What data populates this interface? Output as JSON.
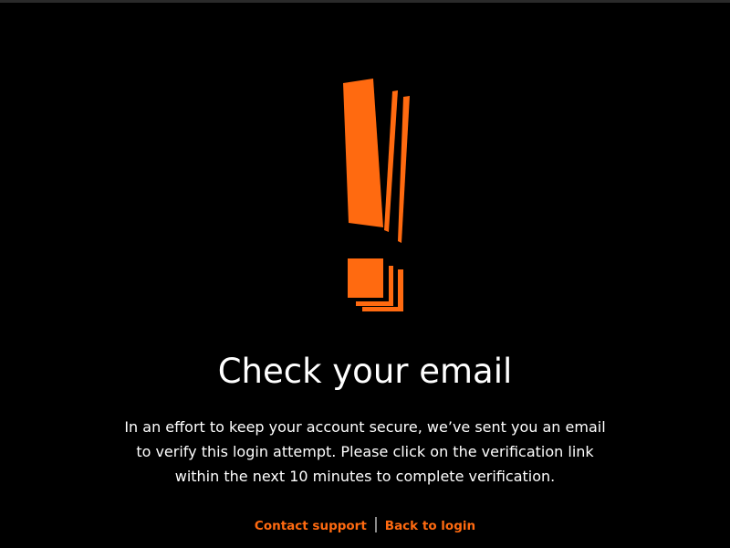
{
  "colors": {
    "background": "#000000",
    "accent": "#ff6a10",
    "text": "#ffffff",
    "separator": "#8a8a8a"
  },
  "icon": "exclamation-icon",
  "title": "Check your email",
  "message": "In an effort to keep your account secure, we’ve sent you an email to verify this login attempt. Please click on the verification link within the next 10 minutes to complete verification.",
  "links": {
    "contact_support": "Contact support",
    "back_to_login": "Back to login"
  }
}
